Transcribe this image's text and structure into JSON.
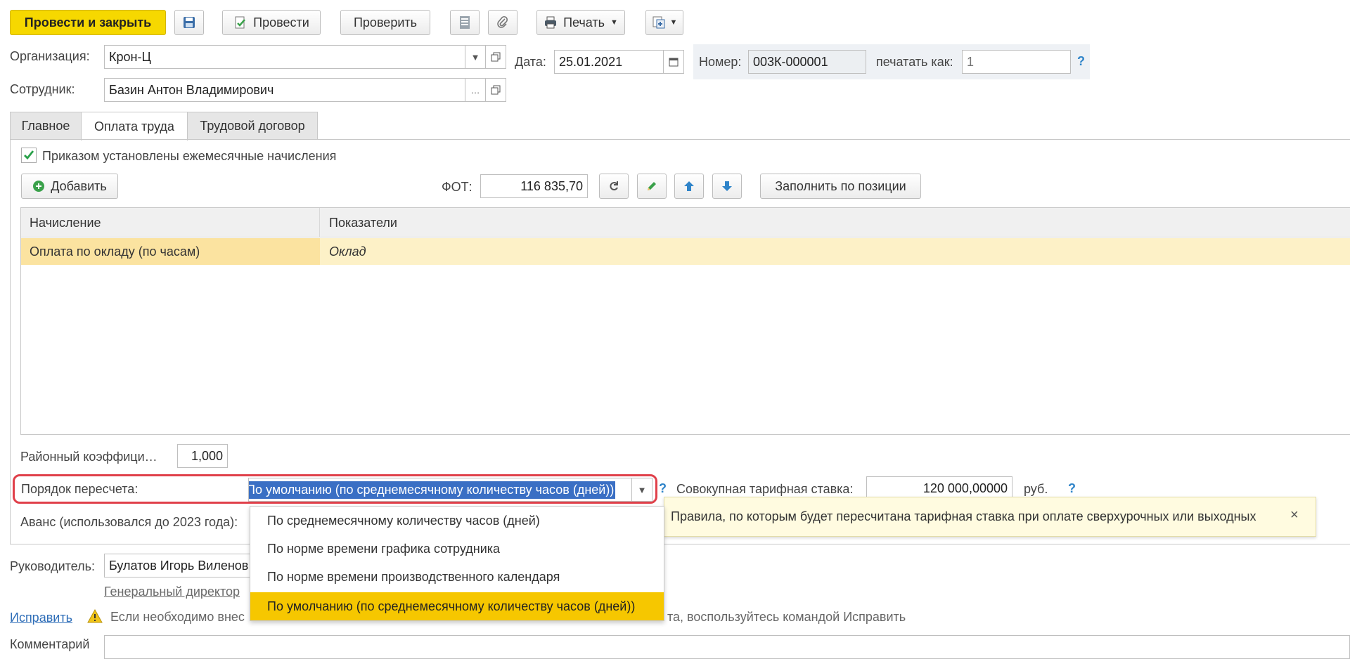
{
  "toolbar": {
    "post_close": "Провести и закрыть",
    "save_icon": "floppy-disk-icon",
    "post": "Провести",
    "check": "Проверить",
    "print": "Печать"
  },
  "header": {
    "org_label": "Организация:",
    "org_value": "Крон-Ц",
    "date_label": "Дата:",
    "date_value": "25.01.2021",
    "number_label": "Номер:",
    "number_value": "003К-000001",
    "print_as_label": "печатать как:",
    "print_as_placeholder": "1",
    "employee_label": "Сотрудник:",
    "employee_value": "Базин Антон Владимирович"
  },
  "tabs": [
    "Главное",
    "Оплата труда",
    "Трудовой договор"
  ],
  "pay": {
    "checkbox_label": "Приказом установлены ежемесячные начисления",
    "add_label": "Добавить",
    "fot_label": "ФОТ:",
    "fot_value": "116 835,70",
    "fill_by_position": "Заполнить по позиции",
    "columns": [
      "Начисление",
      "Показатели"
    ],
    "rows": [
      {
        "accrual": "Оплата по окладу (по часам)",
        "indicators": "Оклад"
      }
    ],
    "regional_label": "Районный коэффици…",
    "regional_value": "1,000",
    "recalc_label": "Порядок пересчета:",
    "recalc_value": "По умолчанию (по среднемесячному количеству часов (дней))",
    "total_rate_label": "Совокупная тарифная ставка:",
    "total_rate_value": "120 000,00000",
    "currency": "руб.",
    "advance_label": "Аванс (использовался до 2023 года):"
  },
  "dropdown": {
    "options": [
      "По среднемесячному количеству часов (дней)",
      "По норме времени графика сотрудника",
      "По норме времени производственного календаря",
      "По умолчанию (по среднемесячному количеству часов (дней))"
    ],
    "selected_index": 3
  },
  "tooltip": {
    "text": "Правила, по которым будет пересчитана тарифная ставка при оплате сверхурочных или выходных",
    "close": "×"
  },
  "footer": {
    "manager_label": "Руководитель:",
    "manager_value": "Булатов Игорь Виленов",
    "manager_position": "Генеральный директор",
    "fix_link": "Исправить",
    "warning_left": "Если необходимо внес",
    "warning_right": "та, воспользуйтесь командой Исправить",
    "comment_label": "Комментарий"
  },
  "colors": {
    "accent_yellow": "#f6d800",
    "selection_row": "#fdf1c7",
    "highlight_outline": "#e0404a",
    "link_blue": "#2f84c9",
    "selected_text_bg": "#3a6fc4",
    "tooltip_bg": "#fffbe0"
  }
}
